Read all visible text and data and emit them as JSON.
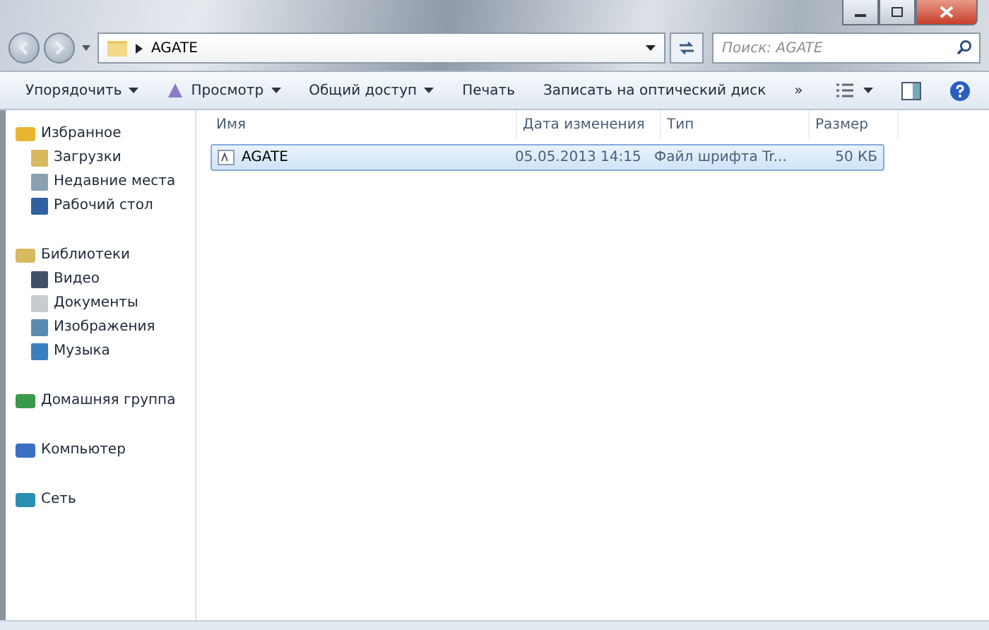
{
  "address": {
    "path": "AGATE"
  },
  "search": {
    "placeholder": "Поиск: AGATE"
  },
  "toolbar": [
    {
      "label": "Упорядочить",
      "dropdown": true
    },
    {
      "label": "Просмотр",
      "dropdown": true
    },
    {
      "label": "Общий доступ",
      "dropdown": true
    },
    {
      "label": "Печать",
      "dropdown": false
    },
    {
      "label": "Записать на оптический диск",
      "dropdown": false
    }
  ],
  "toolbar_overflow": "»",
  "sidebar": {
    "groups": [
      {
        "label": "Избранное",
        "children": [
          {
            "label": "Загрузки"
          },
          {
            "label": "Недавние места"
          },
          {
            "label": "Рабочий стол"
          }
        ]
      },
      {
        "label": "Библиотеки",
        "children": [
          {
            "label": "Видео"
          },
          {
            "label": "Документы"
          },
          {
            "label": "Изображения"
          },
          {
            "label": "Музыка"
          }
        ]
      },
      {
        "label": "Домашняя группа"
      },
      {
        "label": "Компьютер"
      },
      {
        "label": "Сеть"
      }
    ]
  },
  "table": {
    "columns": [
      "Имя",
      "Дата изменения",
      "Тип",
      "Размер"
    ],
    "rows": [
      {
        "cells": [
          "AGATE",
          "05.05.2013 14:15",
          "Файл шрифта Tr...",
          "50 КБ"
        ],
        "selected": true
      }
    ]
  }
}
